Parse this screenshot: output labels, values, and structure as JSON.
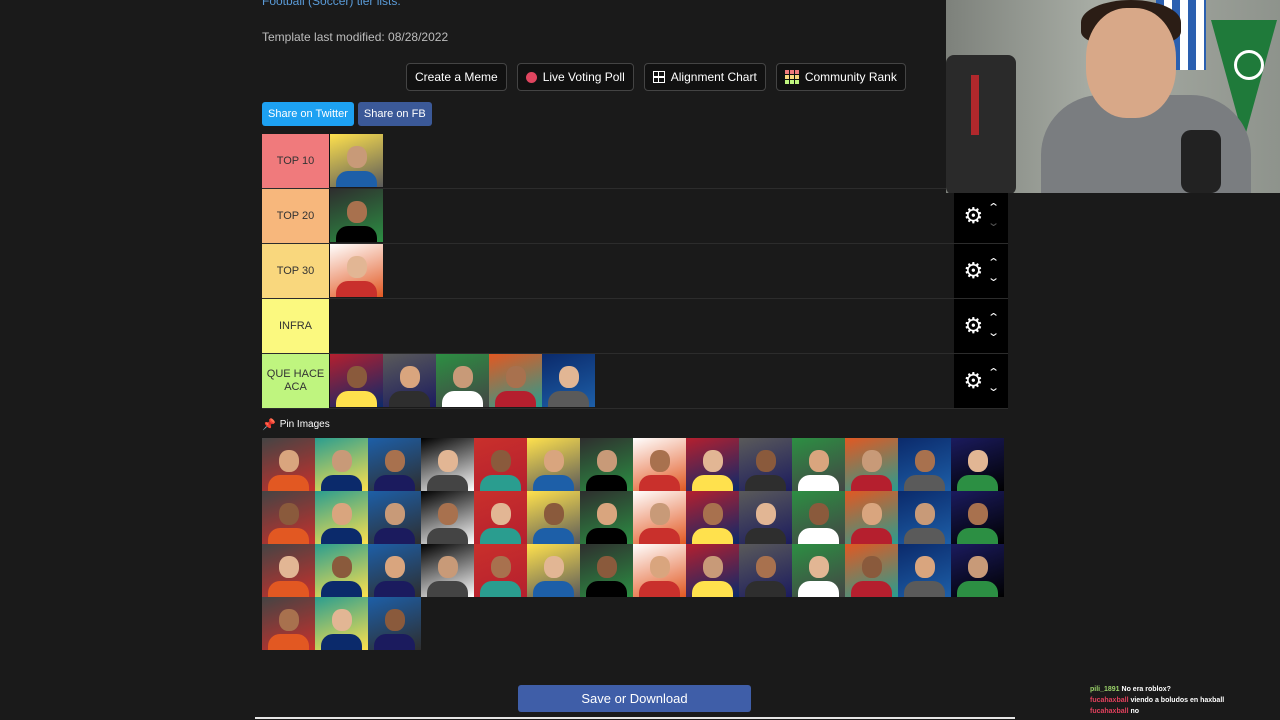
{
  "header": {
    "link_text": "Football (Soccer) tier lists.",
    "modified_text": "Template last modified: 08/28/2022"
  },
  "toolbar": {
    "create_meme": "Create a Meme",
    "live_poll": "Live Voting Poll",
    "alignment_chart": "Alignment Chart",
    "community_rank": "Community Rank"
  },
  "share": {
    "twitter": "Share on Twitter",
    "facebook": "Share on FB"
  },
  "tiers": [
    {
      "label": "TOP 10",
      "color": "#f07a7c"
    },
    {
      "label": "TOP 20",
      "color": "#f7b77c"
    },
    {
      "label": "TOP 30",
      "color": "#f9d77d"
    },
    {
      "label": "INFRA",
      "color": "#fbf97f"
    },
    {
      "label": "QUE HACE ACA",
      "color": "#bff57f"
    }
  ],
  "pin_label": "Pin Images",
  "save_label": "Save or Download",
  "chat": [
    {
      "user": "pili_1891",
      "message": "No era roblox?"
    },
    {
      "user": "fucahaxball",
      "message": "viendo a boludos en haxball"
    },
    {
      "user": "fucahaxball",
      "message": "no"
    }
  ]
}
